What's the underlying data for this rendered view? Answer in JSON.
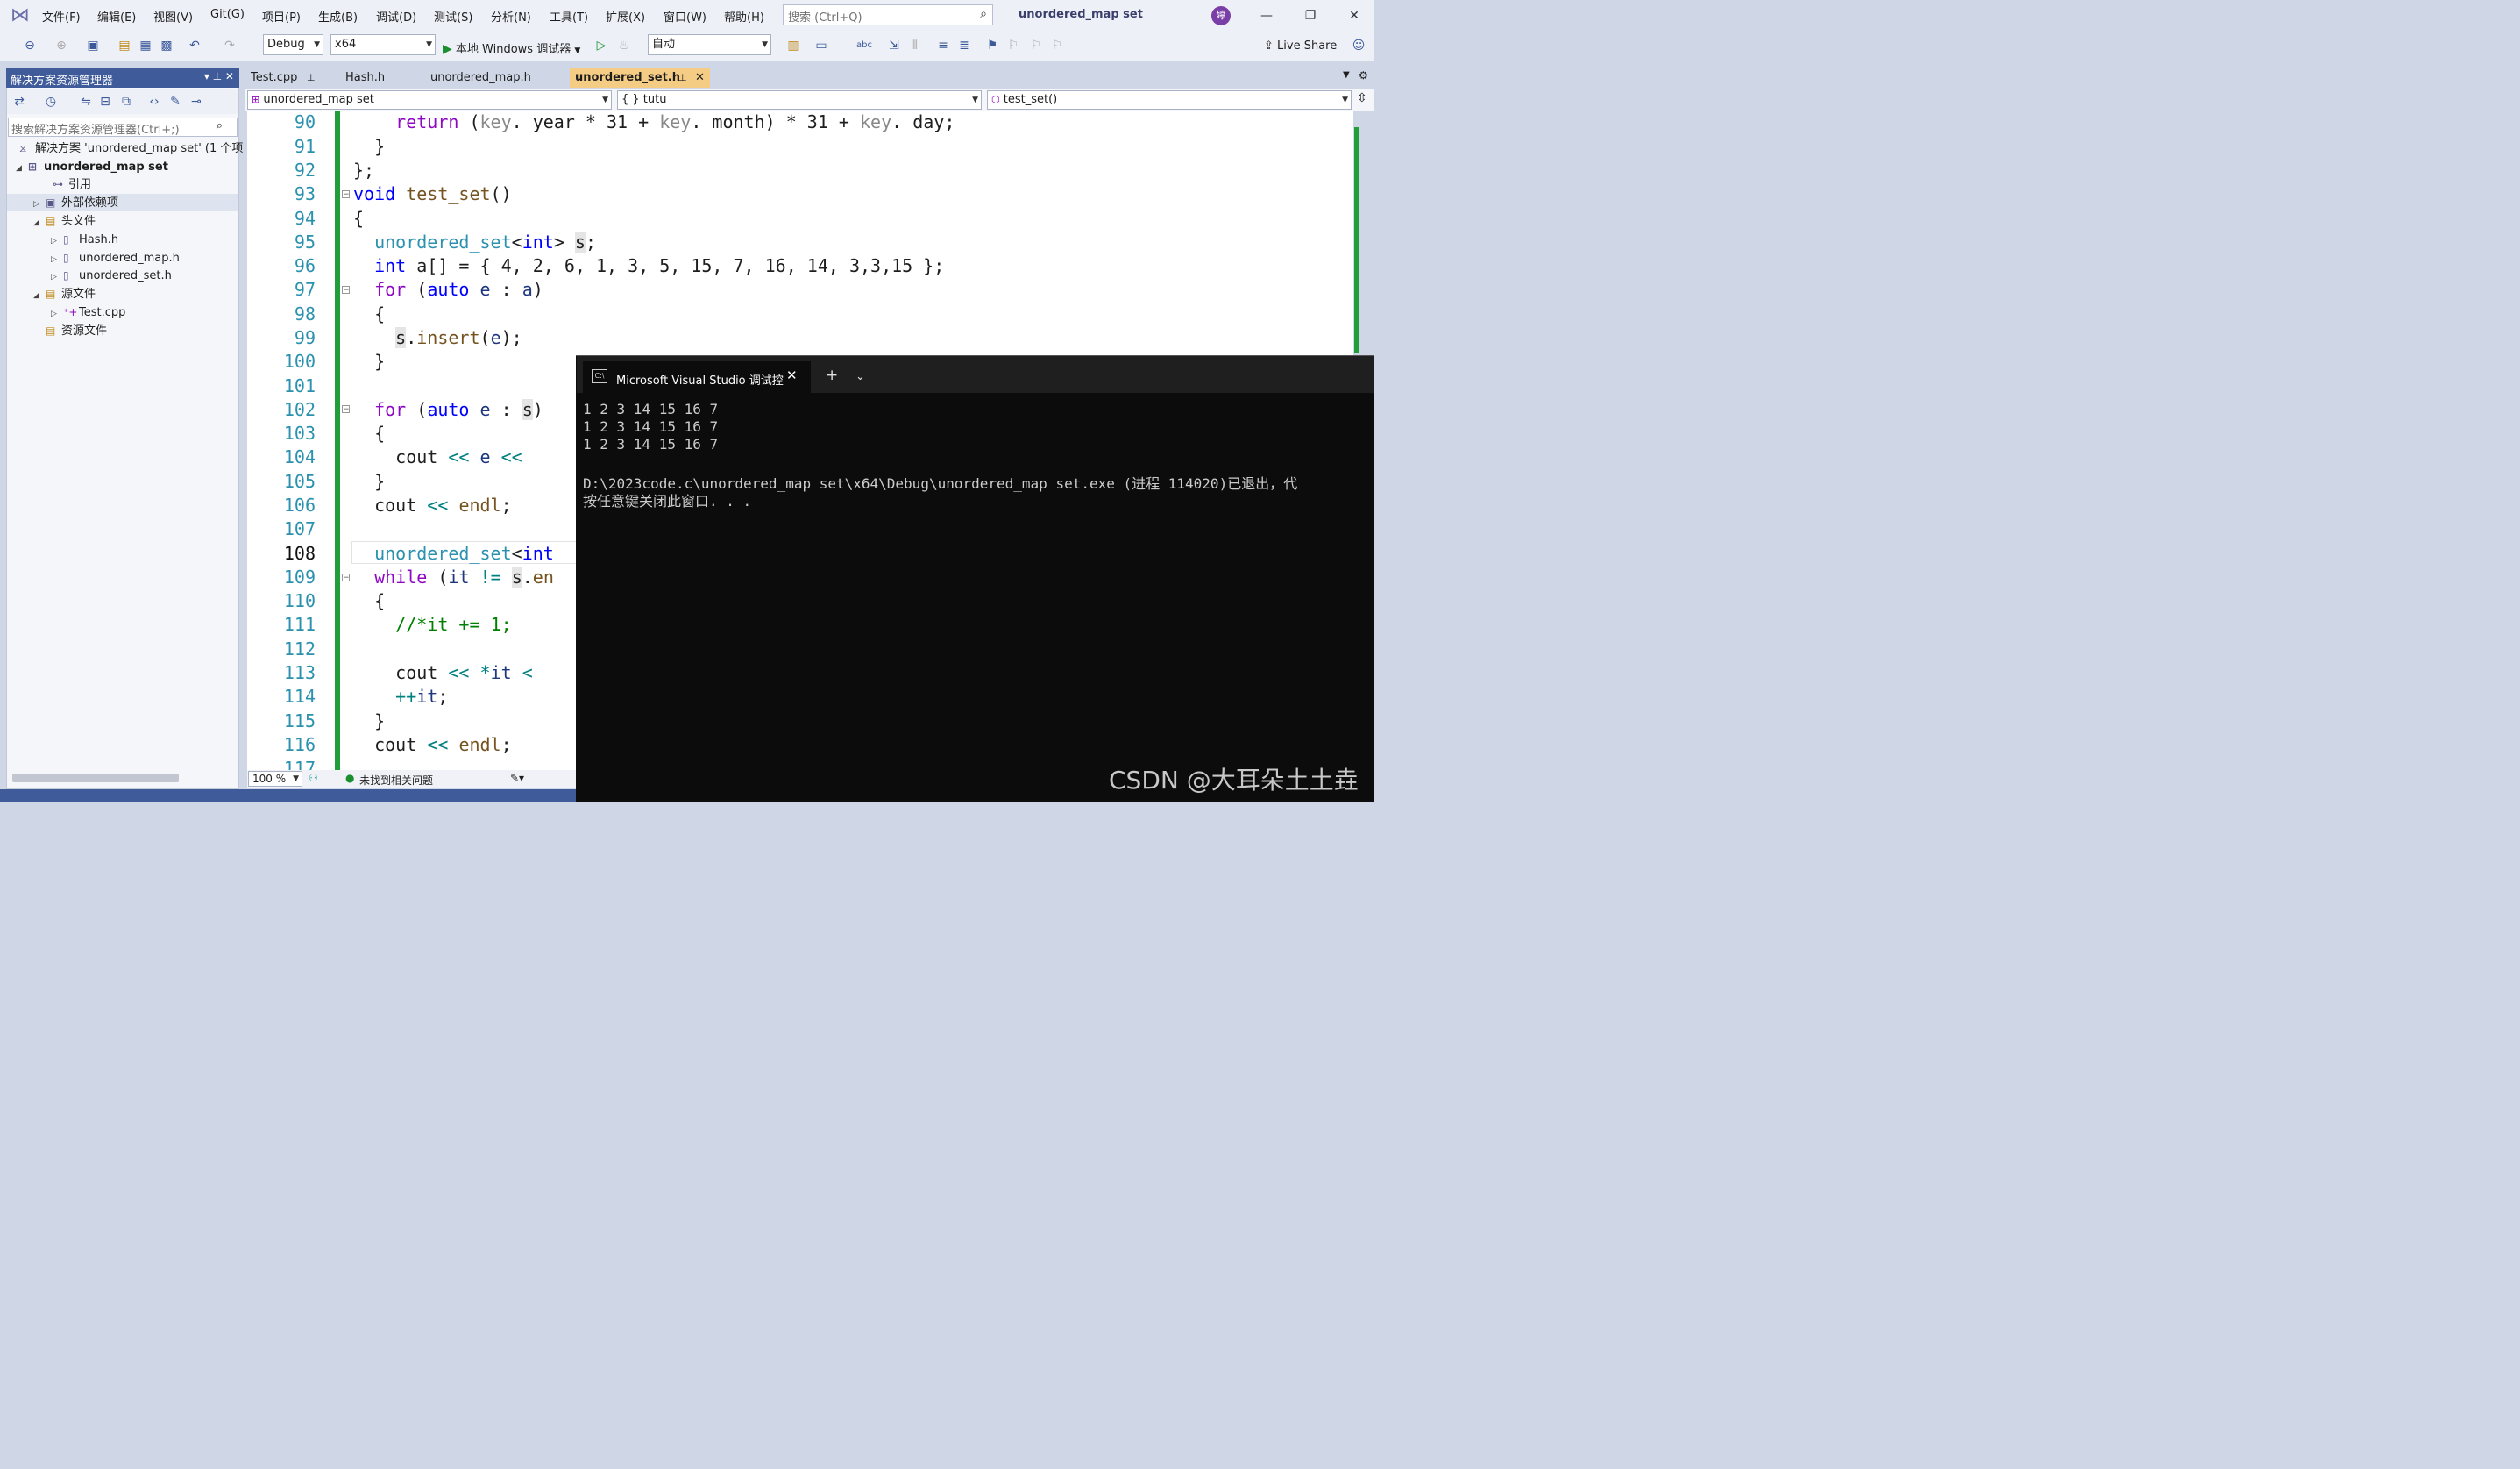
{
  "menubar": {
    "items": [
      "文件(F)",
      "编辑(E)",
      "视图(V)",
      "Git(G)",
      "项目(P)",
      "生成(B)",
      "调试(D)",
      "测试(S)",
      "分析(N)",
      "工具(T)",
      "扩展(X)",
      "窗口(W)",
      "帮助(H)"
    ],
    "search_placeholder": "搜索 (Ctrl+Q)",
    "project_title": "unordered_map set",
    "avatar": "婷"
  },
  "toolbar": {
    "config": "Debug",
    "platform": "x64",
    "run_label": "本地 Windows 调试器",
    "auto": "自动",
    "live_share": "Live Share"
  },
  "solution_explorer": {
    "title": "解决方案资源管理器",
    "search_placeholder": "搜索解决方案资源管理器(Ctrl+;)",
    "items": [
      {
        "label": "解决方案 'unordered_map set' (1 个项",
        "bold": false
      },
      {
        "label": "unordered_map set",
        "bold": true
      },
      {
        "label": "引用",
        "bold": false
      },
      {
        "label": "外部依赖项",
        "bold": false
      },
      {
        "label": "头文件",
        "bold": false
      },
      {
        "label": "Hash.h",
        "bold": false
      },
      {
        "label": "unordered_map.h",
        "bold": false
      },
      {
        "label": "unordered_set.h",
        "bold": false
      },
      {
        "label": "源文件",
        "bold": false
      },
      {
        "label": "Test.cpp",
        "bold": false
      },
      {
        "label": "资源文件",
        "bold": false
      }
    ]
  },
  "tabs": [
    "Test.cpp",
    "Hash.h",
    "unordered_map.h",
    "unordered_set.h"
  ],
  "navbar": {
    "project": "unordered_map set",
    "scope": "{ } tutu",
    "member": "test_set()"
  },
  "editor": {
    "line_numbers": [
      "90",
      "91",
      "92",
      "93",
      "94",
      "95",
      "96",
      "97",
      "98",
      "99",
      "100",
      "101",
      "102",
      "103",
      "104",
      "105",
      "106",
      "107",
      "108",
      "109",
      "110",
      "111",
      "112",
      "113",
      "114",
      "115",
      "116",
      "117"
    ],
    "current_line": "108",
    "zoom": "100 %",
    "issues": "未找到相关问题"
  },
  "console": {
    "tab_title": "Microsoft Visual Studio 调试控",
    "lines": [
      "1 2 3 14 15 16 7",
      "1 2 3 14 15 16 7",
      "1 2 3 14 15 16 7",
      "",
      "D:\\2023code.c\\unordered_map set\\x64\\Debug\\unordered_map set.exe (进程 114020)已退出，代",
      "按任意键关闭此窗口. . ."
    ]
  },
  "watermark": "CSDN @大耳朵土土垚"
}
